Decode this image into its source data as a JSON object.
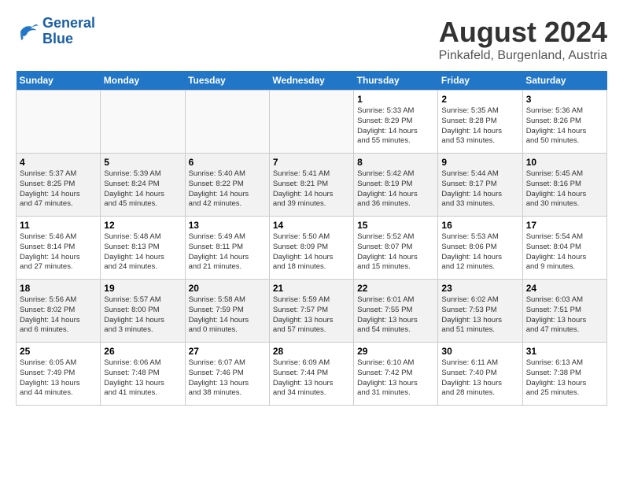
{
  "logo": {
    "line1": "General",
    "line2": "Blue"
  },
  "title": "August 2024",
  "subtitle": "Pinkafeld, Burgenland, Austria",
  "days_of_week": [
    "Sunday",
    "Monday",
    "Tuesday",
    "Wednesday",
    "Thursday",
    "Friday",
    "Saturday"
  ],
  "weeks": [
    [
      {
        "day": "",
        "info": ""
      },
      {
        "day": "",
        "info": ""
      },
      {
        "day": "",
        "info": ""
      },
      {
        "day": "",
        "info": ""
      },
      {
        "day": "1",
        "info": "Sunrise: 5:33 AM\nSunset: 8:29 PM\nDaylight: 14 hours\nand 55 minutes."
      },
      {
        "day": "2",
        "info": "Sunrise: 5:35 AM\nSunset: 8:28 PM\nDaylight: 14 hours\nand 53 minutes."
      },
      {
        "day": "3",
        "info": "Sunrise: 5:36 AM\nSunset: 8:26 PM\nDaylight: 14 hours\nand 50 minutes."
      }
    ],
    [
      {
        "day": "4",
        "info": "Sunrise: 5:37 AM\nSunset: 8:25 PM\nDaylight: 14 hours\nand 47 minutes."
      },
      {
        "day": "5",
        "info": "Sunrise: 5:39 AM\nSunset: 8:24 PM\nDaylight: 14 hours\nand 45 minutes."
      },
      {
        "day": "6",
        "info": "Sunrise: 5:40 AM\nSunset: 8:22 PM\nDaylight: 14 hours\nand 42 minutes."
      },
      {
        "day": "7",
        "info": "Sunrise: 5:41 AM\nSunset: 8:21 PM\nDaylight: 14 hours\nand 39 minutes."
      },
      {
        "day": "8",
        "info": "Sunrise: 5:42 AM\nSunset: 8:19 PM\nDaylight: 14 hours\nand 36 minutes."
      },
      {
        "day": "9",
        "info": "Sunrise: 5:44 AM\nSunset: 8:17 PM\nDaylight: 14 hours\nand 33 minutes."
      },
      {
        "day": "10",
        "info": "Sunrise: 5:45 AM\nSunset: 8:16 PM\nDaylight: 14 hours\nand 30 minutes."
      }
    ],
    [
      {
        "day": "11",
        "info": "Sunrise: 5:46 AM\nSunset: 8:14 PM\nDaylight: 14 hours\nand 27 minutes."
      },
      {
        "day": "12",
        "info": "Sunrise: 5:48 AM\nSunset: 8:13 PM\nDaylight: 14 hours\nand 24 minutes."
      },
      {
        "day": "13",
        "info": "Sunrise: 5:49 AM\nSunset: 8:11 PM\nDaylight: 14 hours\nand 21 minutes."
      },
      {
        "day": "14",
        "info": "Sunrise: 5:50 AM\nSunset: 8:09 PM\nDaylight: 14 hours\nand 18 minutes."
      },
      {
        "day": "15",
        "info": "Sunrise: 5:52 AM\nSunset: 8:07 PM\nDaylight: 14 hours\nand 15 minutes."
      },
      {
        "day": "16",
        "info": "Sunrise: 5:53 AM\nSunset: 8:06 PM\nDaylight: 14 hours\nand 12 minutes."
      },
      {
        "day": "17",
        "info": "Sunrise: 5:54 AM\nSunset: 8:04 PM\nDaylight: 14 hours\nand 9 minutes."
      }
    ],
    [
      {
        "day": "18",
        "info": "Sunrise: 5:56 AM\nSunset: 8:02 PM\nDaylight: 14 hours\nand 6 minutes."
      },
      {
        "day": "19",
        "info": "Sunrise: 5:57 AM\nSunset: 8:00 PM\nDaylight: 14 hours\nand 3 minutes."
      },
      {
        "day": "20",
        "info": "Sunrise: 5:58 AM\nSunset: 7:59 PM\nDaylight: 14 hours\nand 0 minutes."
      },
      {
        "day": "21",
        "info": "Sunrise: 5:59 AM\nSunset: 7:57 PM\nDaylight: 13 hours\nand 57 minutes."
      },
      {
        "day": "22",
        "info": "Sunrise: 6:01 AM\nSunset: 7:55 PM\nDaylight: 13 hours\nand 54 minutes."
      },
      {
        "day": "23",
        "info": "Sunrise: 6:02 AM\nSunset: 7:53 PM\nDaylight: 13 hours\nand 51 minutes."
      },
      {
        "day": "24",
        "info": "Sunrise: 6:03 AM\nSunset: 7:51 PM\nDaylight: 13 hours\nand 47 minutes."
      }
    ],
    [
      {
        "day": "25",
        "info": "Sunrise: 6:05 AM\nSunset: 7:49 PM\nDaylight: 13 hours\nand 44 minutes."
      },
      {
        "day": "26",
        "info": "Sunrise: 6:06 AM\nSunset: 7:48 PM\nDaylight: 13 hours\nand 41 minutes."
      },
      {
        "day": "27",
        "info": "Sunrise: 6:07 AM\nSunset: 7:46 PM\nDaylight: 13 hours\nand 38 minutes."
      },
      {
        "day": "28",
        "info": "Sunrise: 6:09 AM\nSunset: 7:44 PM\nDaylight: 13 hours\nand 34 minutes."
      },
      {
        "day": "29",
        "info": "Sunrise: 6:10 AM\nSunset: 7:42 PM\nDaylight: 13 hours\nand 31 minutes."
      },
      {
        "day": "30",
        "info": "Sunrise: 6:11 AM\nSunset: 7:40 PM\nDaylight: 13 hours\nand 28 minutes."
      },
      {
        "day": "31",
        "info": "Sunrise: 6:13 AM\nSunset: 7:38 PM\nDaylight: 13 hours\nand 25 minutes."
      }
    ]
  ]
}
